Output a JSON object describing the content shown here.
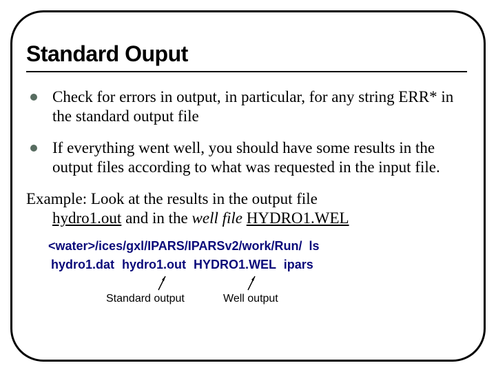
{
  "title": "Standard Ouput",
  "bullets": [
    "Check for errors in output, in particular, for any string ERR* in the standard output file",
    "If everything went well, you should have some results in the output files according to what was requested in the input file."
  ],
  "example": {
    "lead": "Example:",
    "body_pre": " Look at the results in the output file ",
    "file1": "hydro1.out",
    "mid": " and in the ",
    "well_file_phrase": "well file",
    "space": " ",
    "file2": "HYDRO1.WEL"
  },
  "cmd": {
    "path": "<water>/ices/gxl/IPARS/IPARSv2/work/Run/",
    "cmd": "ls"
  },
  "files": {
    "f1": "hydro1.dat",
    "f2": "hydro1.out",
    "f3": "HYDRO1.WEL",
    "f4": "ipars"
  },
  "annot": {
    "left": "Standard output",
    "right": "Well output"
  }
}
